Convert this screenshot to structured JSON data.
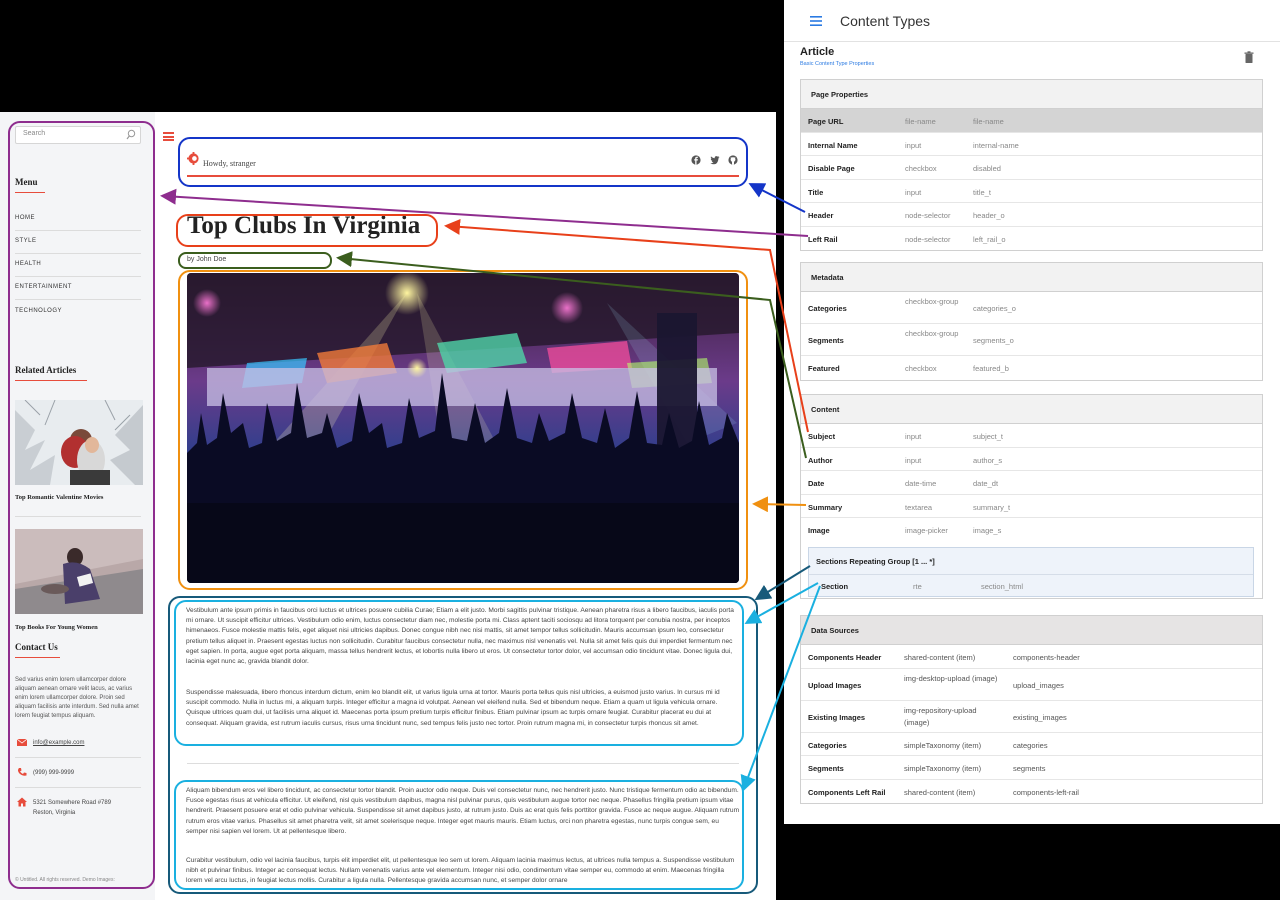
{
  "site": {
    "search_placeholder": "Search",
    "menu_heading": "Menu",
    "menu_items": [
      "HOME",
      "STYLE",
      "HEALTH",
      "ENTERTAINMENT",
      "TECHNOLOGY"
    ],
    "related_heading": "Related Articles",
    "related": [
      {
        "title": "Top Romantic Valentine Movies"
      },
      {
        "title": "Top Books For Young Women"
      }
    ],
    "contact_heading": "Contact Us",
    "contact_text": "Sed varius enim lorem ullamcorper dolore aliquam aenean ornare velit lacus, ac varius enim lorem ullamcorper dolore. Proin sed aliquam facilisis ante interdum. Sed nulla amet lorem feugiat tempus aliquam.",
    "email": "info@example.com",
    "phone": "(999) 999-9999",
    "address_line1": "5321 Somewhere Road #789",
    "address_line2": "Reston, Virginia",
    "copyright": "© Untitled. All rights reserved. Demo Images:",
    "greeting": "Howdy, stranger",
    "article_title": "Top Clubs In Virginia",
    "byline": "by John Doe",
    "paragraphs": [
      "Vestibulum ante ipsum primis in faucibus orci luctus et ultrices posuere cubilia Curae; Etiam a elit justo. Morbi sagittis pulvinar tristique. Aenean pharetra risus a libero faucibus, iaculis porta mi ornare. Ut suscipit efficitur ultrices. Vestibulum odio enim, luctus consectetur diam nec, molestie porta mi. Class aptent taciti sociosqu ad litora torquent per conubia nostra, per inceptos himenaeos. Fusce molestie mattis felis, eget aliquet nisi ultricies dapibus. Donec congue nibh nec nisi mattis, sit amet tempor tellus sollicitudin. Mauris accumsan ipsum leo, consectetur pretium tellus aliquet in. Praesent egestas luctus non sollicitudin. Curabitur faucibus consectetur nulla, nec maximus nisl venenatis vel. Nulla sit amet felis quis dui imperdiet fermentum nec eget sapien. In porta, augue eget porta aliquam, massa tellus hendrerit lectus, et lobortis nulla libero ut eros. Ut consectetur tortor dolor, vel accumsan odio tincidunt vitae. Donec ligula dui, lacinia eget nunc ac, gravida blandit dolor.",
      "Suspendisse malesuada, libero rhoncus interdum dictum, enim leo blandit elit, ut varius ligula urna at tortor. Mauris porta tellus quis nisl ultricies, a euismod justo varius. In cursus mi id suscipit commodo. Nulla in luctus mi, a aliquam turpis. Integer efficitur a magna id volutpat. Aenean vel eleifend nulla. Sed et bibendum neque. Etiam a quam ut ligula vehicula ornare. Quisque ultrices quam dui, ut facilisis urna aliquet id. Maecenas porta ipsum pretium turpis efficitur finibus. Etiam pulvinar ipsum ac turpis ornare feugiat. Curabitur placerat eu dui at consequat. Aliquam gravida, est rutrum iaculis cursus, risus urna tincidunt nunc, sed tempus felis justo nec tortor. Proin rutrum magna mi, in consectetur turpis rhoncus sit amet.",
      "Aliquam bibendum eros vel libero tincidunt, ac consectetur tortor blandit. Proin auctor odio neque. Duis vel consectetur nunc, nec hendrerit justo. Nunc tristique fermentum odio ac bibendum. Fusce egestas risus at vehicula efficitur. Ut eleifend, nisl quis vestibulum dapibus, magna nisl pulvinar purus, quis vestibulum augue tortor nec neque. Phasellus fringilla pretium ipsum vitae hendrerit. Praesent posuere erat et odio pulvinar vehicula. Suspendisse sit amet dapibus justo, at rutrum justo. Duis ac erat quis felis porttitor gravida. Fusce ac neque augue. Aliquam rutrum rutrum eros vitae varius. Phasellus sit amet pharetra velit, sit amet scelerisque neque. Integer eget mauris mauris. Etiam luctus, orci non pharetra egestas, nunc turpis congue sem, eu semper nisi sapien vel lorem. Ut at pellentesque libero.",
      "Curabitur vestibulum, odio vel lacinia faucibus, turpis elit imperdiet elit, ut pellentesque leo sem ut lorem. Aliquam lacinia maximus lectus, at ultrices nulla tempus a. Suspendisse vestibulum nibh et pulvinar finibus. Integer ac consequat lectus. Nullam venenatis varius ante vel elementum. Integer nisi odio, condimentum vitae semper eu, commodo at enim. Maecenas fringilla lorem vel arcu luctus, in feugiat lectus mollis. Curabitur a ligula nulla. Pellentesque gravida accumsan nunc, et semper dolor ornare"
    ]
  },
  "cms": {
    "title": "Content Types",
    "type_name": "Article",
    "type_sub": "Basic Content Type Properties",
    "page_properties": {
      "heading": "Page Properties",
      "rows": [
        [
          "Page URL",
          "file-name",
          "file-name"
        ],
        [
          "Internal Name",
          "input",
          "internal-name"
        ],
        [
          "Disable Page",
          "checkbox",
          "disabled"
        ],
        [
          "Title",
          "input",
          "title_t"
        ],
        [
          "Header",
          "node-selector",
          "header_o"
        ],
        [
          "Left Rail",
          "node-selector",
          "left_rail_o"
        ]
      ]
    },
    "metadata": {
      "heading": "Metadata",
      "rows": [
        [
          "Categories",
          "checkbox-group",
          "categories_o"
        ],
        [
          "Segments",
          "checkbox-group",
          "segments_o"
        ],
        [
          "Featured",
          "checkbox",
          "featured_b"
        ]
      ]
    },
    "content": {
      "heading": "Content",
      "rows": [
        [
          "Subject",
          "input",
          "subject_t"
        ],
        [
          "Author",
          "input",
          "author_s"
        ],
        [
          "Date",
          "date-time",
          "date_dt"
        ],
        [
          "Summary",
          "textarea",
          "summary_t"
        ],
        [
          "Image",
          "image-picker",
          "image_s"
        ]
      ],
      "repeat_group": {
        "heading": "Sections Repeating Group [1 ... *]",
        "row": [
          "Section",
          "rte",
          "section_html"
        ]
      }
    },
    "data_sources": {
      "heading": "Data Sources",
      "rows": [
        [
          "Components Header",
          "shared-content (item)",
          "components-header"
        ],
        [
          "Upload Images",
          "img-desktop-upload (image)",
          "upload_images"
        ],
        [
          "Existing Images",
          "img-repository-upload (image)",
          "existing_images"
        ],
        [
          "Categories",
          "simpleTaxonomy (item)",
          "categories"
        ],
        [
          "Segments",
          "simpleTaxonomy (item)",
          "segments"
        ],
        [
          "Components Left Rail",
          "shared-content (item)",
          "components-left-rail"
        ]
      ]
    }
  },
  "colors": {
    "accent_red": "#e74c3c",
    "left_rail": "#8e2d8e",
    "header": "#1435c8",
    "title": "#e8401a",
    "author": "#3b5e1e",
    "summary": "#f09010",
    "image_section": "#175a7a",
    "section": "#1ab0e0",
    "cms_link": "#2a7ae2"
  },
  "icons": [
    "search-icon",
    "menu-icon",
    "logo-icon",
    "facebook-icon",
    "twitter-icon",
    "github-icon",
    "mail-icon",
    "phone-icon",
    "home-icon",
    "trash-icon"
  ]
}
